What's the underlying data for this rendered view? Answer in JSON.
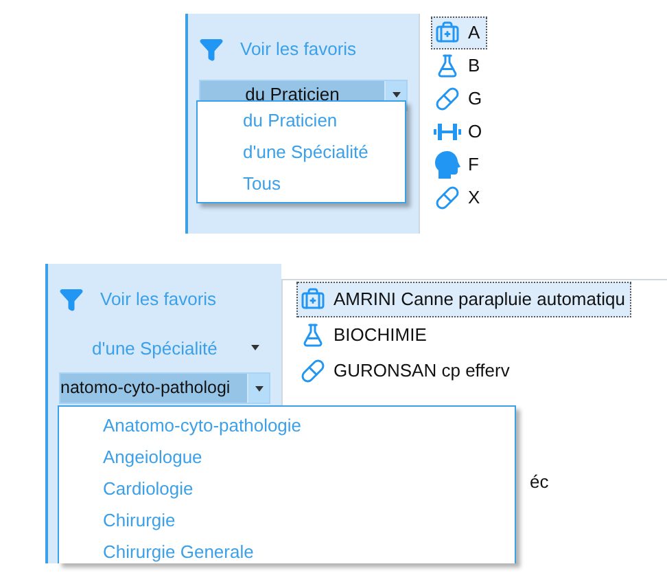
{
  "panels": [
    {
      "sidebar": {
        "favorites_label": "Voir les favoris",
        "combo": {
          "value": "du Praticien",
          "open": true
        },
        "dropdown": [
          "du Praticien",
          "d'une Spécialité",
          "Tous"
        ]
      },
      "list": [
        {
          "kind": "medkit",
          "text": "A",
          "selected": true
        },
        {
          "kind": "flask",
          "text": "B",
          "selected": false
        },
        {
          "kind": "pill",
          "text": "G",
          "selected": false
        },
        {
          "kind": "dumbbell",
          "text": "O",
          "selected": false
        },
        {
          "kind": "brain",
          "text": "F",
          "selected": false
        },
        {
          "kind": "pill",
          "text": "X",
          "selected": false
        }
      ]
    },
    {
      "sidebar": {
        "favorites_label": "Voir les favoris",
        "scope_selector": "d'une Spécialité",
        "combo": {
          "value": "natomo-cyto-pathologi",
          "open": true
        },
        "dropdown": [
          "Anatomo-cyto-pathologie",
          "Angeiologue",
          "Cardiologie",
          "Chirurgie",
          "Chirurgie Generale"
        ]
      },
      "list": [
        {
          "kind": "medkit",
          "text": "AMRINI Canne parapluie automatiqu",
          "selected": true
        },
        {
          "kind": "flask",
          "text": "BIOCHIMIE",
          "selected": false
        },
        {
          "kind": "pill",
          "text": "GURONSAN cp efferv",
          "selected": false
        },
        {
          "kind": "fragment",
          "text": "éc"
        }
      ]
    }
  ]
}
